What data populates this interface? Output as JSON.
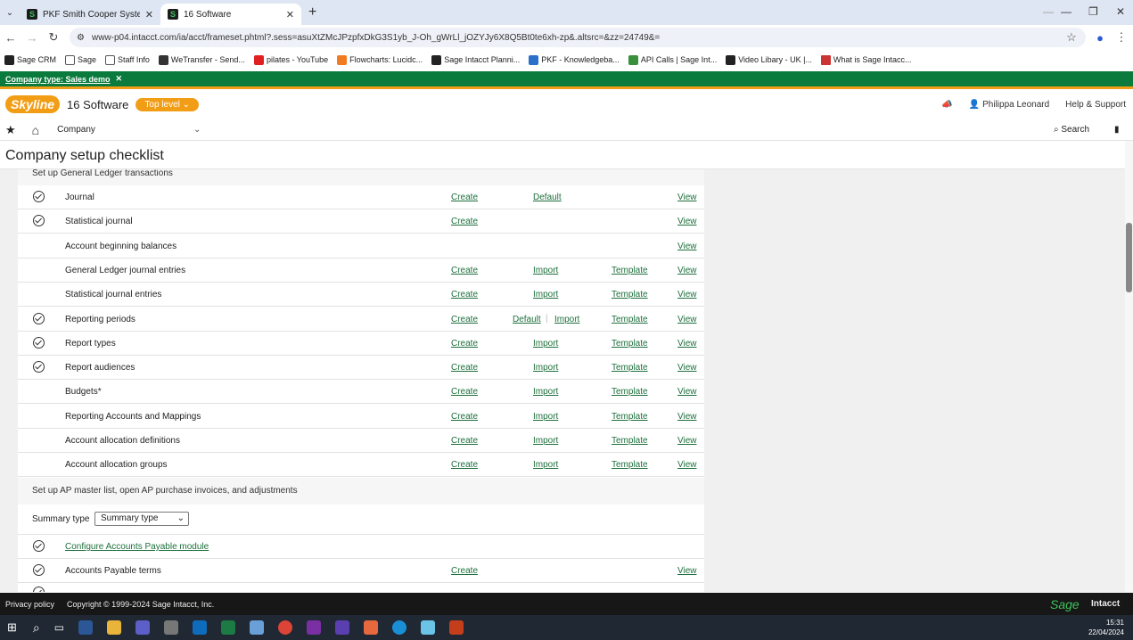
{
  "browser": {
    "tabs": [
      {
        "title": "PKF Smith Cooper Systems",
        "active": false
      },
      {
        "title": "16 Software",
        "active": true
      }
    ],
    "url": "www-p04.intacct.com/ia/acct/frameset.phtml?.sess=asuXtZMcJPzpfxDkG3S1yb_J-Oh_gWrLl_jOZYJy6X8Q5Bt0te6xh-zp&.altsrc=&zz=24749&=",
    "bookmarks": [
      "Sage CRM",
      "Sage",
      "Staff Info",
      "WeTransfer - Send...",
      "pilates - YouTube",
      "Flowcharts: Lucidc...",
      "Sage Intacct Planni...",
      "PKF - Knowledgeba...",
      "API Calls | Sage Int...",
      "Video Libary - UK |...",
      "What is Sage Intacc..."
    ]
  },
  "banner": {
    "company_type": "Company type: Sales demo"
  },
  "header": {
    "logo": "Skyline",
    "company": "16 Software",
    "level": "Top level",
    "user": "Philippa Leonard",
    "help": "Help & Support"
  },
  "menu": {
    "company": "Company",
    "search": "Search"
  },
  "page": {
    "title": "Company setup checklist"
  },
  "gl_section": {
    "heading": "Set up General Ledger transactions",
    "rows": [
      {
        "label": "Journal",
        "check": true,
        "create": "Create",
        "default": "Default",
        "view": "View"
      },
      {
        "label": "Statistical journal",
        "check": true,
        "create": "Create",
        "view": "View"
      },
      {
        "label": "Account beginning balances",
        "check": false,
        "view": "View"
      },
      {
        "label": "General Ledger journal entries",
        "check": false,
        "create": "Create",
        "import": "Import",
        "template": "Template",
        "view": "View"
      },
      {
        "label": "Statistical journal entries",
        "check": false,
        "create": "Create",
        "import": "Import",
        "template": "Template",
        "view": "View"
      },
      {
        "label": "Reporting periods",
        "check": true,
        "create": "Create",
        "default": "Default",
        "import": "Import",
        "template": "Template",
        "view": "View"
      },
      {
        "label": "Report types",
        "check": true,
        "create": "Create",
        "import": "Import",
        "template": "Template",
        "view": "View"
      },
      {
        "label": "Report audiences",
        "check": true,
        "create": "Create",
        "import": "Import",
        "template": "Template",
        "view": "View"
      },
      {
        "label": "Budgets*",
        "check": false,
        "create": "Create",
        "import": "Import",
        "template": "Template",
        "view": "View"
      },
      {
        "label": "Reporting Accounts and Mappings",
        "check": false,
        "create": "Create",
        "import": "Import",
        "template": "Template",
        "view": "View"
      },
      {
        "label": "Account allocation definitions",
        "check": false,
        "create": "Create",
        "import": "Import",
        "template": "Template",
        "view": "View"
      },
      {
        "label": "Account allocation groups",
        "check": false,
        "create": "Create",
        "import": "Import",
        "template": "Template",
        "view": "View"
      }
    ]
  },
  "ap_section": {
    "heading": "Set up AP master list, open AP purchase invoices, and adjustments",
    "summary_label": "Summary type",
    "summary_value": "Summary type",
    "rows": [
      {
        "label": "Configure Accounts Payable module",
        "check": true,
        "link": true
      },
      {
        "label": "Accounts Payable terms",
        "check": true,
        "create": "Create",
        "view": "View"
      }
    ]
  },
  "footer": {
    "privacy": "Privacy policy",
    "copyright": "Copyright © 1999-2024 Sage Intacct, Inc.",
    "brand1": "Sage",
    "brand2": "Intacct"
  },
  "taskbar": {
    "time": "15:31",
    "date": "22/04/2024"
  }
}
